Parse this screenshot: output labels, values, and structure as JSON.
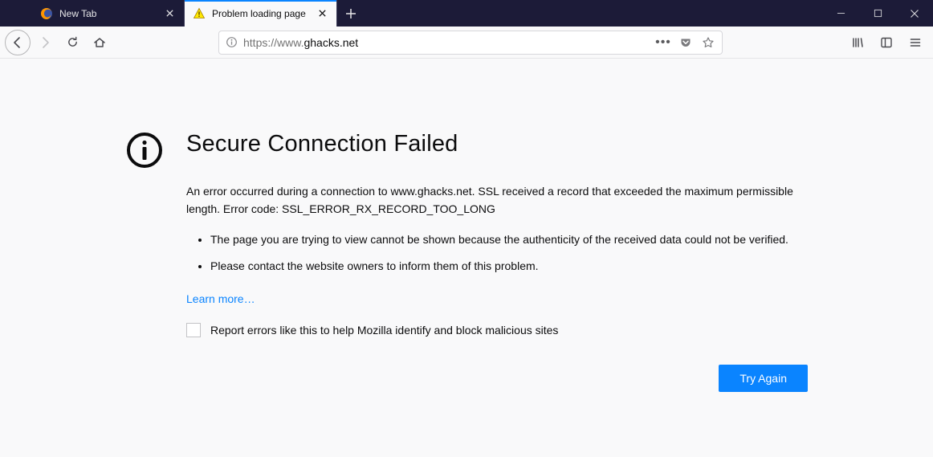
{
  "tabs": [
    {
      "title": "New Tab",
      "active": false
    },
    {
      "title": "Problem loading page",
      "active": true
    }
  ],
  "url": {
    "scheme": "https://",
    "prefix": "www.",
    "host": "ghacks.net"
  },
  "error": {
    "title": "Secure Connection Failed",
    "description": "An error occurred during a connection to www.ghacks.net. SSL received a record that exceeded the maximum permissible length. Error code: SSL_ERROR_RX_RECORD_TOO_LONG",
    "bullets": [
      "The page you are trying to view cannot be shown because the authenticity of the received data could not be verified.",
      "Please contact the website owners to inform them of this problem."
    ],
    "learn_more": "Learn more…",
    "report_label": "Report errors like this to help Mozilla identify and block malicious sites",
    "try_again": "Try Again"
  }
}
